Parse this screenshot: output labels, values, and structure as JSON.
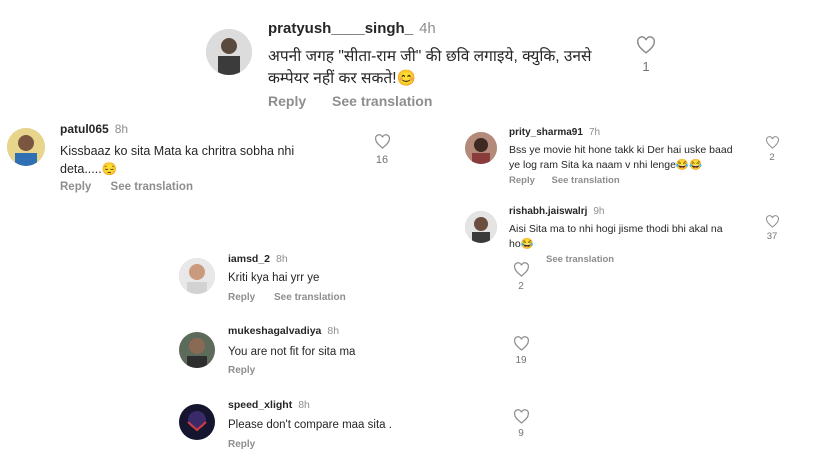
{
  "comments": [
    {
      "username": "pratyush____singh_",
      "time": "4h",
      "text_line1": "अपनी जगह \"सीता-राम जी\" की छवि लगाइये, क्युकि, उनसे",
      "text_line2": "कम्पेयर नहीं कर सकते!😊",
      "reply": "Reply",
      "translate": "See translation",
      "likes": "1"
    },
    {
      "username": "patul065",
      "time": "8h",
      "text_line1": "Kissbaaz ko sita Mata ka chritra sobha nhi",
      "text_line2": "deta.....😔",
      "reply": "Reply",
      "translate": "See translation",
      "likes": "16"
    },
    {
      "username": "prity_sharma91",
      "time": "7h",
      "text_line1": "Bss ye movie hit hone takk ki Der hai uske baad",
      "text_line2": "ye log ram Sita ka naam v nhi lenge😂😂",
      "reply": "Reply",
      "translate": "See translation",
      "likes": "2"
    },
    {
      "username": "rishabh.jaiswalrj",
      "time": "9h",
      "text_line1": "Aisi Sita ma to nhi hogi jisme thodi bhi akal na",
      "text_line2": "ho😂",
      "translate": "See translation",
      "likes": "37",
      "likes_left": "2"
    },
    {
      "username": "iamsd_2",
      "time": "8h",
      "text_line1": "Kriti kya hai yrr ye",
      "reply": "Reply",
      "translate": "See translation"
    },
    {
      "username": "mukeshagalvadiya",
      "time": "8h",
      "text_line1": "You are not fit for sita ma",
      "reply": "Reply",
      "likes": "19"
    },
    {
      "username": "speed_xlight",
      "time": "8h",
      "text_line1": "Please don't compare maa sita .",
      "reply": "Reply",
      "likes": "9"
    }
  ]
}
